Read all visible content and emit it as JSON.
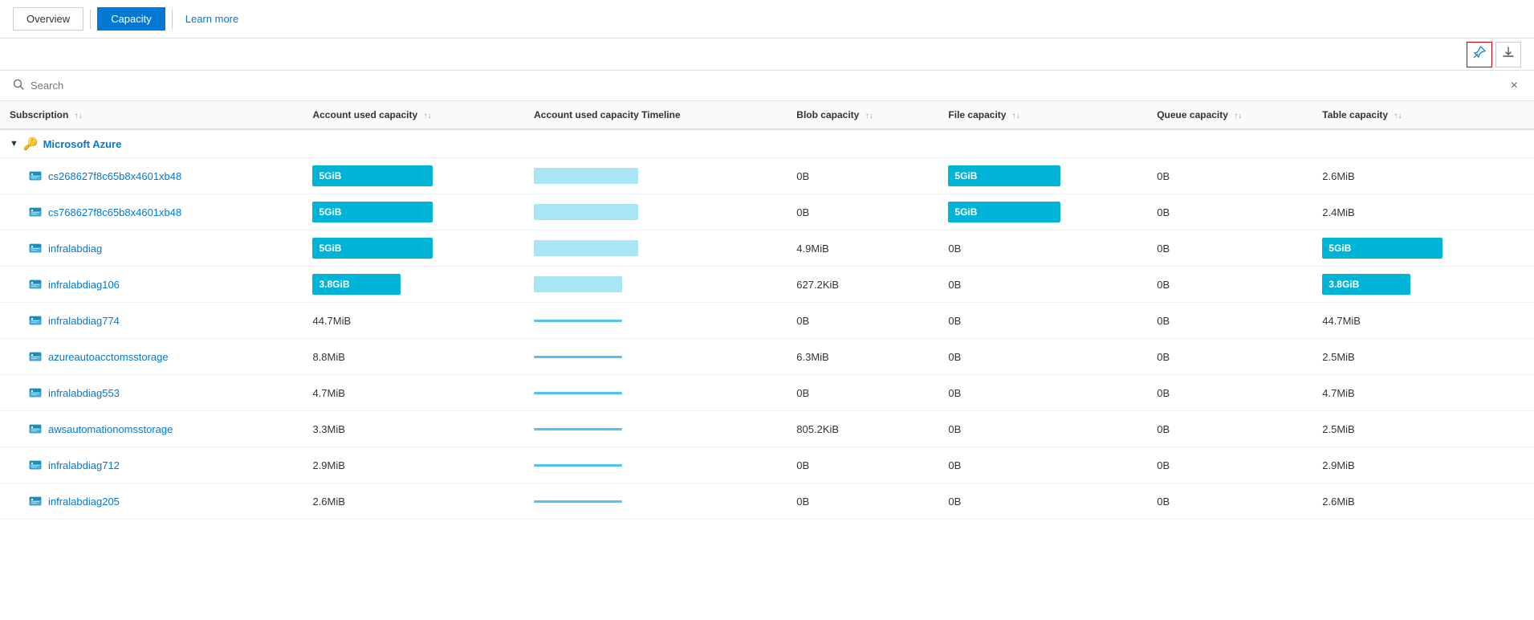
{
  "nav": {
    "overview_label": "Overview",
    "capacity_label": "Capacity",
    "learn_more_label": "Learn more"
  },
  "toolbar": {
    "pin_icon": "📌",
    "download_icon": "⬇"
  },
  "search": {
    "placeholder": "Search",
    "clear_label": "×"
  },
  "table": {
    "columns": [
      {
        "id": "subscription",
        "label": "Subscription",
        "sortable": true
      },
      {
        "id": "account_used_capacity",
        "label": "Account used capacity",
        "sortable": true
      },
      {
        "id": "account_used_capacity_timeline",
        "label": "Account used capacity Timeline",
        "sortable": false
      },
      {
        "id": "blob_capacity",
        "label": "Blob capacity",
        "sortable": true
      },
      {
        "id": "file_capacity",
        "label": "File capacity",
        "sortable": true
      },
      {
        "id": "queue_capacity",
        "label": "Queue capacity",
        "sortable": true
      },
      {
        "id": "table_capacity",
        "label": "Table capacity",
        "sortable": true
      }
    ],
    "group": {
      "name": "Microsoft Azure",
      "icon": "key"
    },
    "rows": [
      {
        "name": "cs268627f8c65b8x4601xb48",
        "account_used_capacity": "5GiB",
        "account_used_capacity_bar": "large",
        "timeline": "large",
        "blob_capacity": "0B",
        "file_capacity": "5GiB",
        "file_capacity_bar": true,
        "queue_capacity": "0B",
        "table_capacity": "2.6MiB",
        "table_capacity_bar": false
      },
      {
        "name": "cs768627f8c65b8x4601xb48",
        "account_used_capacity": "5GiB",
        "account_used_capacity_bar": "large",
        "timeline": "large",
        "blob_capacity": "0B",
        "file_capacity": "5GiB",
        "file_capacity_bar": true,
        "queue_capacity": "0B",
        "table_capacity": "2.4MiB",
        "table_capacity_bar": false
      },
      {
        "name": "infralabdiag",
        "account_used_capacity": "5GiB",
        "account_used_capacity_bar": "large",
        "timeline": "large",
        "blob_capacity": "4.9MiB",
        "file_capacity": "0B",
        "file_capacity_bar": false,
        "queue_capacity": "0B",
        "table_capacity": "5GiB",
        "table_capacity_bar": true
      },
      {
        "name": "infralabdiag106",
        "account_used_capacity": "3.8GiB",
        "account_used_capacity_bar": "medium",
        "timeline": "medium",
        "blob_capacity": "627.2KiB",
        "file_capacity": "0B",
        "file_capacity_bar": false,
        "queue_capacity": "0B",
        "table_capacity": "3.8GiB",
        "table_capacity_bar": true
      },
      {
        "name": "infralabdiag774",
        "account_used_capacity": "44.7MiB",
        "account_used_capacity_bar": "none",
        "timeline": "thin",
        "blob_capacity": "0B",
        "file_capacity": "0B",
        "file_capacity_bar": false,
        "queue_capacity": "0B",
        "table_capacity": "44.7MiB",
        "table_capacity_bar": false
      },
      {
        "name": "azureautoacctomsstorage",
        "account_used_capacity": "8.8MiB",
        "account_used_capacity_bar": "none",
        "timeline": "thin",
        "blob_capacity": "6.3MiB",
        "file_capacity": "0B",
        "file_capacity_bar": false,
        "queue_capacity": "0B",
        "table_capacity": "2.5MiB",
        "table_capacity_bar": false
      },
      {
        "name": "infralabdiag553",
        "account_used_capacity": "4.7MiB",
        "account_used_capacity_bar": "none",
        "timeline": "thin",
        "blob_capacity": "0B",
        "file_capacity": "0B",
        "file_capacity_bar": false,
        "queue_capacity": "0B",
        "table_capacity": "4.7MiB",
        "table_capacity_bar": false
      },
      {
        "name": "awsautomationomsstorage",
        "account_used_capacity": "3.3MiB",
        "account_used_capacity_bar": "none",
        "timeline": "thin",
        "blob_capacity": "805.2KiB",
        "file_capacity": "0B",
        "file_capacity_bar": false,
        "queue_capacity": "0B",
        "table_capacity": "2.5MiB",
        "table_capacity_bar": false
      },
      {
        "name": "infralabdiag712",
        "account_used_capacity": "2.9MiB",
        "account_used_capacity_bar": "none",
        "timeline": "thin",
        "blob_capacity": "0B",
        "file_capacity": "0B",
        "file_capacity_bar": false,
        "queue_capacity": "0B",
        "table_capacity": "2.9MiB",
        "table_capacity_bar": false
      },
      {
        "name": "infralabdiag205",
        "account_used_capacity": "2.6MiB",
        "account_used_capacity_bar": "none",
        "timeline": "thin",
        "blob_capacity": "0B",
        "file_capacity": "0B",
        "file_capacity_bar": false,
        "queue_capacity": "0B",
        "table_capacity": "2.6MiB",
        "table_capacity_bar": false
      }
    ]
  }
}
